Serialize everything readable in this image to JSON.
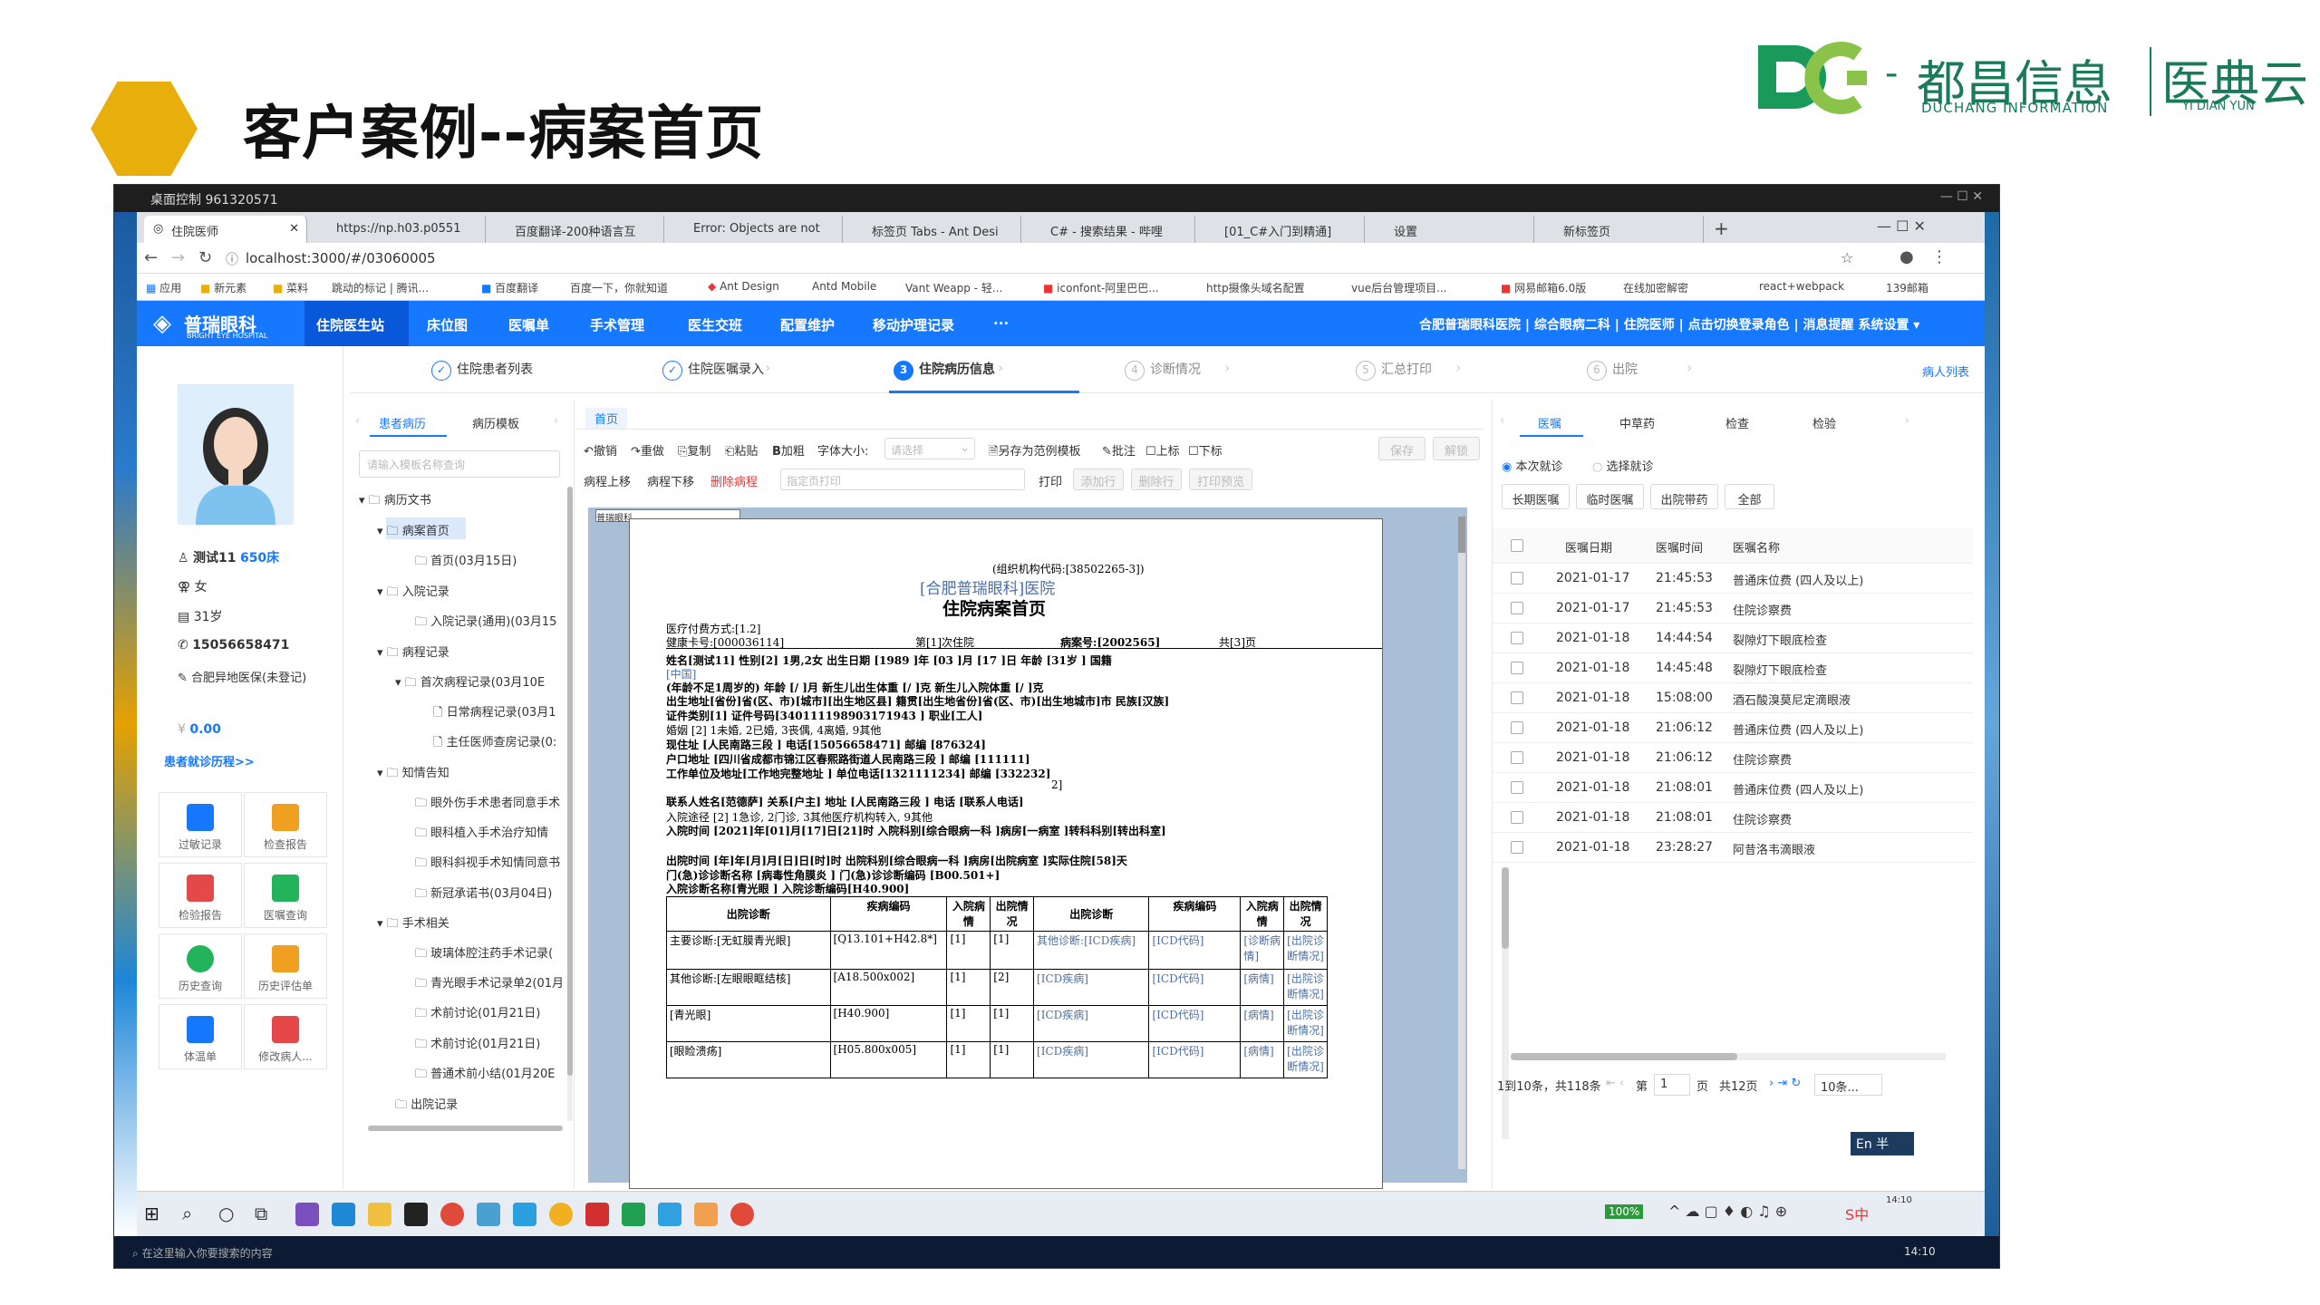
{
  "slide": {
    "title": "客户案例--病案首页"
  },
  "logo": {
    "brand_cn": "都昌信息",
    "brand_en": "DUCHANG INFORMATION",
    "product_cn": "医典云",
    "product_en": "YI DIAN YUN",
    "dash": "-"
  },
  "remote_bar": {
    "title": "桌面控制 961320571"
  },
  "browser": {
    "tabs": [
      "住院医师",
      "https://np.h03.p0551",
      "百度翻译-200种语言互",
      "Error: Objects are not",
      "标签页 Tabs - Ant Desi",
      "C# - 搜索结果 - 哔哩",
      "[01_C#入门到精通]",
      "设置",
      "新标签页"
    ],
    "url": "localhost:3000/#/03060005",
    "bookmarks": [
      "应用",
      "新元素",
      "菜料",
      "跳动的标记 | 腾讯...",
      "百度翻译",
      "百度一下，你就知道",
      "Ant Design",
      "Antd Mobile",
      "Vant Weapp - 轻...",
      "iconfont-阿里巴巴...",
      "http摄像头域名配置",
      "vue后台管理项目...",
      "网易邮箱6.0版",
      "在线加密解密",
      "react+webpack",
      "139邮箱"
    ]
  },
  "app": {
    "logo_text": "普瑞眼科",
    "logo_sub": "BRIGHT EYE HOSPITAL",
    "nav": [
      "住院医生站",
      "床位图",
      "医嘱单",
      "手术管理",
      "医生交班",
      "配置维护",
      "移动护理记录",
      "···"
    ],
    "nav_right": "合肥普瑞眼科医院 | 综合眼病二科 | 住院医师 | 点击切换登录角色 | 消息提醒  系统设置 ▾",
    "steps": [
      "住院患者列表",
      "住院医嘱录入",
      "住院病历信息",
      "诊断情况",
      "汇总打印",
      "出院"
    ],
    "step_numbers": [
      "3",
      "4",
      "5",
      "6"
    ],
    "patient_list_link": "病人列表"
  },
  "patient": {
    "name": "测试11",
    "bed": "650床",
    "sex": "女",
    "age": "31岁",
    "phone": "15056658471",
    "insurance": "合肥异地医保(未登记)",
    "balance": "0.00",
    "history_link": "患者就诊历程>>",
    "buttons": [
      "过敏记录",
      "检查报告",
      "检验报告",
      "医嘱查询",
      "历史查询",
      "历史评估单",
      "体温单",
      "修改病人..."
    ]
  },
  "tree": {
    "tabs": [
      "患者病历",
      "病历模板"
    ],
    "search_placeholder": "请输入模板名称查询",
    "nodes": [
      "病历文书",
      "病案首页",
      "首页(03月15日)",
      "入院记录",
      "入院记录(通用)(03月15",
      "病程记录",
      "首次病程记录(03月10E",
      "日常病程记录(03月1",
      "主任医师查房记录(0:",
      "知情告知",
      "眼外伤手术患者同意手术",
      "眼科植入手术治疗知情",
      "眼科斜视手术知情同意书",
      "新冠承诺书(03月04日)",
      "手术相关",
      "玻璃体腔注药手术记录(",
      "青光眼手术记录单2(01月",
      "术前讨论(01月21日)",
      "术前讨论(01月21日)",
      "普通术前小结(01月20E",
      "出院记录"
    ]
  },
  "editor": {
    "tab": "首页",
    "toolbar": [
      "撤销",
      "重做",
      "复制",
      "粘贴",
      "加粗",
      "字体大小:",
      "另存为范例模板",
      "批注",
      "上标",
      "下标"
    ],
    "font_size_placeholder": "请选择",
    "save": "保存",
    "unlock": "解锁",
    "row2": [
      "病程上移",
      "病程下移",
      "删除病程"
    ],
    "print_placeholder": "指定页打印",
    "print": "打印",
    "print_btns": [
      "添加行",
      "删除行",
      "打印预览"
    ]
  },
  "record": {
    "header_label": "普瑞眼科",
    "org_code": "(组织机构代码:[38502265-3])",
    "hospital": "[合肥普瑞眼科]医院",
    "title": "住院病案首页",
    "pay": "医疗付费方式:[1.2]",
    "card": "健康卡号:[000036114]",
    "times": "第[1]次住院",
    "case_no_label": "病案号:",
    "case_no": "[2002565]",
    "pages": "共[3]页",
    "line_name": "姓名[测试11] 性别[2] 1男,2女 出生日期 [1989 ]年 [03 ]月 [17 ]日 年龄 [31岁 ] 国籍",
    "country": "[中国]",
    "line_infant": "(年龄不足1周岁的) 年龄 [/ ]月 新生儿出生体重 [/ ]克 新生儿入院体重 [/ ]克",
    "line_birth": "出生地址[省份]省(区、市)[城市][出生地区县] 籍贯[出生地省份]省(区、市)[出生地城市]市 民族[汉族]",
    "line_id": "证件类别[1] 证件号码[340111198903171943 ] 职业[工人]",
    "line_marry": "婚姻 [2] 1未婚, 2已婚, 3丧偶, 4离婚, 9其他",
    "line_addr": "现住址 [人民南路三段 ] 电话[15056658471] 邮编 [876324]",
    "line_hukou": "户口地址 [四川省成都市锦江区春熙路街道人民南路三段 ] 邮编 [111111]",
    "line_work": "工作单位及地址[工作地完整地址 ] 单位电话[1321111234] 邮编 [332232]",
    "line_work2": "2]",
    "line_contact": "联系人姓名[范德萨] 关系[户主] 地址 [人民南路三段 ] 电话 [联系人电话]",
    "line_route": "入院途径 [2] 1急诊, 2门诊, 3其他医疗机构转入, 9其他",
    "line_intime": "入院时间 [2021]年[01]月[17]日[21]时 入院科别[综合眼病一科 ]病房[一病室 ]转科科别[转出科室]",
    "line_outtime": "出院时间 [年]年[月]月[日]日[时]时 出院科别[综合眼病一科 ]病房[出院病室 ]实际住院[58]天",
    "line_opd": "门(急)诊诊断名称 [病毒性角膜炎 ] 门(急)诊诊断编码 [B00.501+]",
    "line_admit_dx": "入院诊断名称[青光眼 ] 入院诊断编码[H40.900]",
    "table_headers": [
      "出院诊断",
      "疾病编码",
      "入院病情",
      "出院情况",
      "出院诊断",
      "疾病编码",
      "入院病情",
      "出院情况"
    ],
    "table_rows": [
      [
        "主要诊断:[无虹膜青光眼]",
        "[Q13.101+H42.8*]",
        "[1]",
        "[1]",
        "其他诊断:[ICD疾病]",
        "[ICD代码]",
        "[诊断病情]",
        "[出院诊断情况]"
      ],
      [
        "其他诊断:[左眼眼眶结核]",
        "[A18.500x002]",
        "[1]",
        "[2]",
        "[ICD疾病]",
        "[ICD代码]",
        "[病情]",
        "[出院诊断情况]"
      ],
      [
        "[青光眼]",
        "[H40.900]",
        "[1]",
        "[1]",
        "[ICD疾病]",
        "[ICD代码]",
        "[病情]",
        "[出院诊断情况]"
      ],
      [
        "[眼睑溃疡]",
        "[H05.800x005]",
        "[1]",
        "[1]",
        "[ICD疾病]",
        "[ICD代码]",
        "[病情]",
        "[出院诊断情况]"
      ]
    ]
  },
  "orders": {
    "tabs": [
      "医嘱",
      "中草药",
      "检查",
      "检验"
    ],
    "radio": [
      "本次就诊",
      "选择就诊"
    ],
    "filters": [
      "长期医嘱",
      "临时医嘱",
      "出院带药",
      "全部"
    ],
    "headers": [
      "医嘱日期",
      "医嘱时间",
      "医嘱名称"
    ],
    "rows": [
      [
        "2021-01-17",
        "21:45:53",
        "普通床位费 (四人及以上)"
      ],
      [
        "2021-01-17",
        "21:45:53",
        "住院诊察费"
      ],
      [
        "2021-01-18",
        "14:44:54",
        "裂隙灯下眼底检查"
      ],
      [
        "2021-01-18",
        "14:45:48",
        "裂隙灯下眼底检查"
      ],
      [
        "2021-01-18",
        "15:08:00",
        "酒石酸溴莫尼定滴眼液"
      ],
      [
        "2021-01-18",
        "21:06:12",
        "普通床位费 (四人及以上)"
      ],
      [
        "2021-01-18",
        "21:06:12",
        "住院诊察费"
      ],
      [
        "2021-01-18",
        "21:08:01",
        "普通床位费 (四人及以上)"
      ],
      [
        "2021-01-18",
        "21:08:01",
        "住院诊察费"
      ],
      [
        "2021-01-18",
        "23:28:27",
        "阿昔洛韦滴眼液"
      ]
    ],
    "pager": "1到10条，共118条",
    "page_label": "第",
    "page": "1",
    "page_unit": "页",
    "total_pages": "共12页",
    "page_size": "10条..."
  },
  "taskbar": {
    "battery": "100%",
    "ime": "中",
    "time": "14:10",
    "en_badge": "En",
    "half": "半",
    "search_placeholder": "在这里输入你要搜索的内容"
  }
}
